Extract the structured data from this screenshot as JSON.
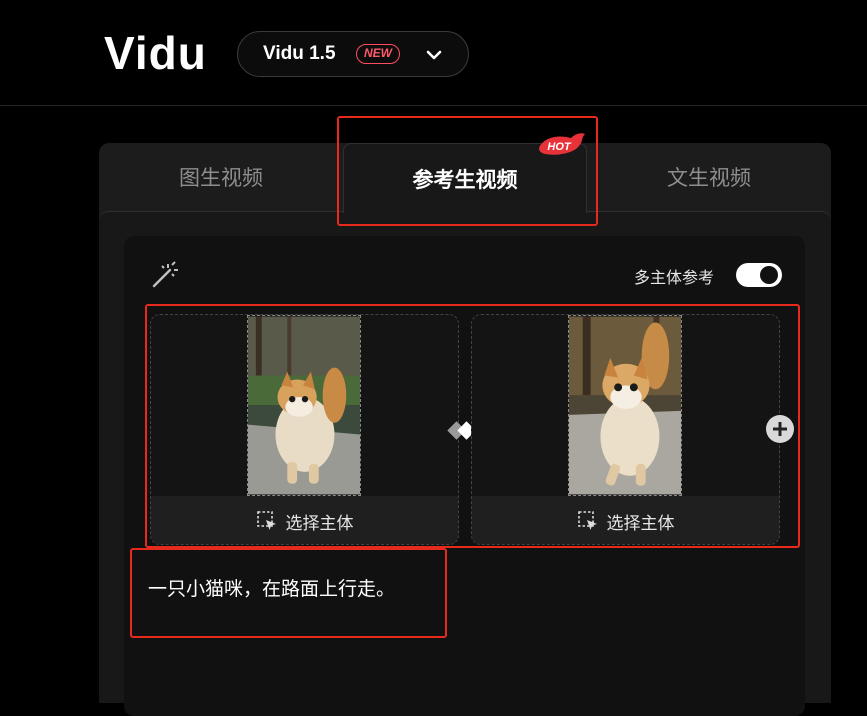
{
  "header": {
    "logo": "Vidu",
    "version_label": "Vidu 1.5",
    "new_badge": "NEW"
  },
  "tabs": [
    {
      "label": "图生视频"
    },
    {
      "label": "参考生视频",
      "badge": "HOT"
    },
    {
      "label": "文生视频"
    }
  ],
  "options": {
    "multi_subject_label": "多主体参考",
    "multi_subject_enabled": true
  },
  "subjects": [
    {
      "label": "选择主体"
    },
    {
      "label": "选择主体"
    }
  ],
  "prompt": "一只小猫咪，在路面上行走。",
  "colors": {
    "highlight_box": "#e62a1c",
    "new_badge": "#ff4d5e",
    "hot_badge": "#e8323a"
  }
}
